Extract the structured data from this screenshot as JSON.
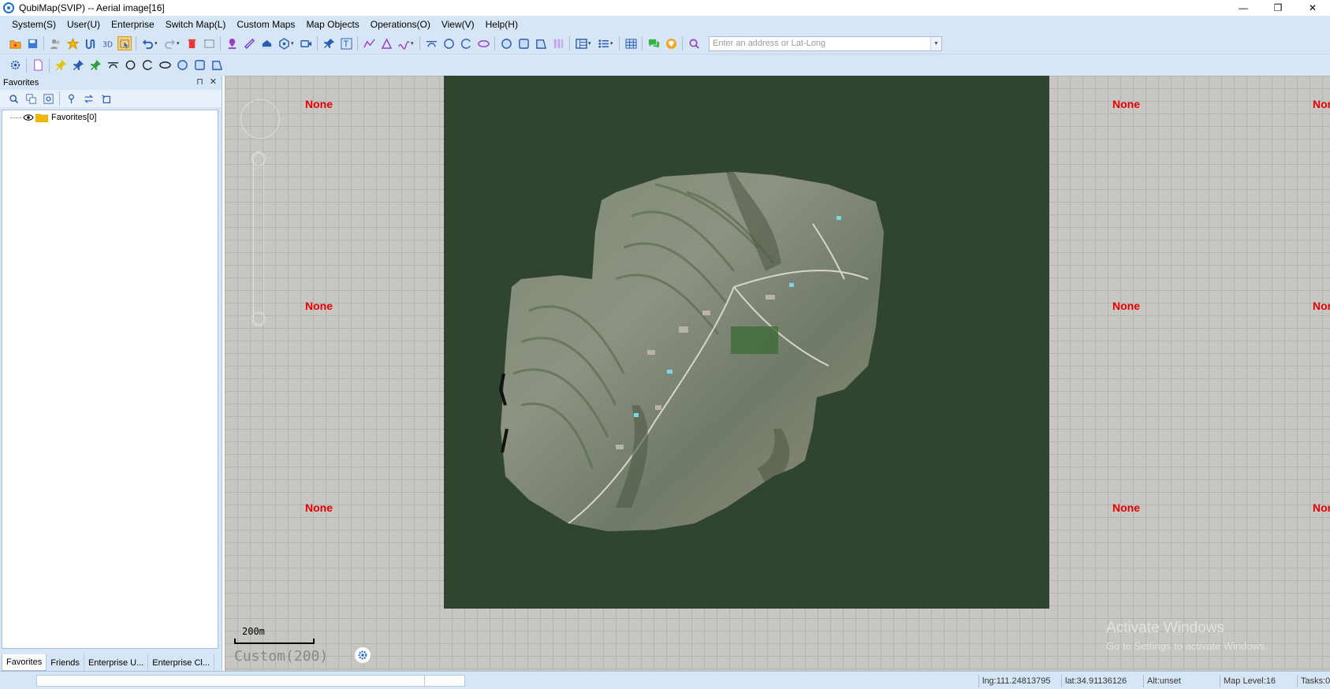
{
  "window": {
    "title": "QubiMap(SVIP) -- Aerial image[16]",
    "minimize_glyph": "—",
    "restore_glyph": "❐",
    "close_glyph": "✕"
  },
  "menu": [
    "System(S)",
    "User(U)",
    "Enterprise",
    "Switch Map(L)",
    "Custom Maps",
    "Map Objects",
    "Operations(O)",
    "View(V)",
    "Help(H)"
  ],
  "toolbar": {
    "address_placeholder": "Enter an address or Lat-Long"
  },
  "panel": {
    "title": "Favorites",
    "pin_glyph": "⊓",
    "close_glyph": "✕",
    "tree": [
      {
        "label": "Favorites[0]"
      }
    ],
    "tabs": [
      "Favorites",
      "Friends",
      "Enterprise U...",
      "Enterprise Cl..."
    ],
    "active_tab": "Favorites"
  },
  "map": {
    "tile_label": "None",
    "scale_label": "200m",
    "custom_label": "Custom(200)",
    "watermark_line1": "Activate Windows",
    "watermark_line2": "Go to Settings to activate Windows."
  },
  "status": {
    "lng": "lng:111.24813795",
    "lat": "lat:34.91136126",
    "alt": "Alt:unset",
    "map_level": "Map Level:16",
    "tasks": "Tasks:0"
  },
  "colors": {
    "accent": "#d6e6f7",
    "map_background": "#c8c6c2",
    "dark_area": "#304530",
    "tile_label": "#e60000"
  }
}
